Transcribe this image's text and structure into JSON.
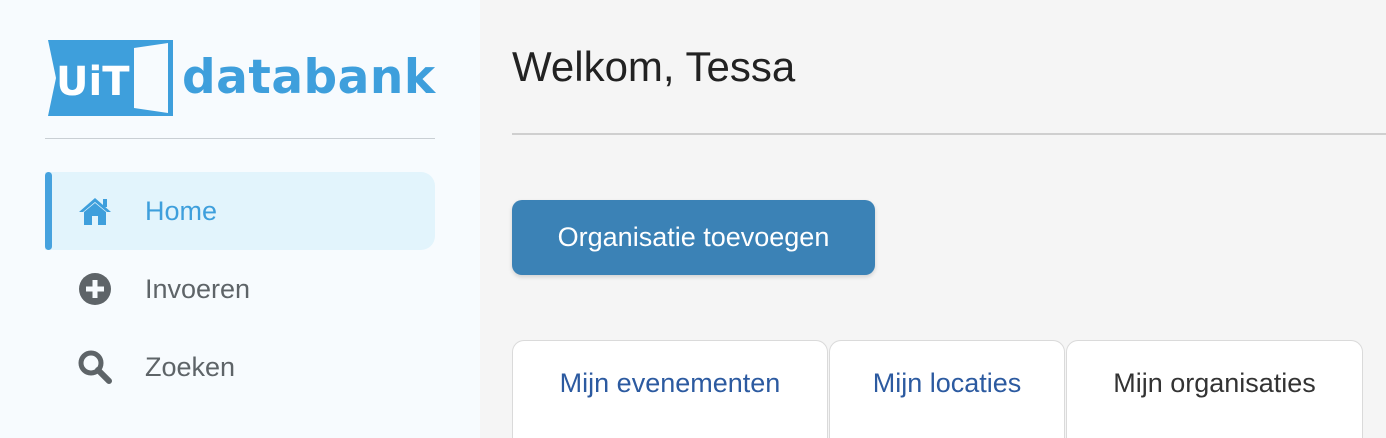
{
  "brand": {
    "logo_badge": "UiT",
    "logo_text": "databank",
    "accent": "#3e9fdc"
  },
  "sidebar": {
    "items": [
      {
        "label": "Home",
        "icon": "home-icon",
        "active": true
      },
      {
        "label": "Invoeren",
        "icon": "plus-circle-icon",
        "active": false
      },
      {
        "label": "Zoeken",
        "icon": "search-icon",
        "active": false
      }
    ]
  },
  "main": {
    "welcome": "Welkom, Tessa",
    "add_org_button": "Organisatie toevoegen",
    "tabs": [
      {
        "label": "Mijn evenementen",
        "active": false
      },
      {
        "label": "Mijn locaties",
        "active": false
      },
      {
        "label": "Mijn organisaties",
        "active": true
      }
    ]
  },
  "colors": {
    "primary_button": "#3b82b6",
    "tab_link": "#2c5aa0",
    "nav_active_bg": "#e2f4fc"
  }
}
